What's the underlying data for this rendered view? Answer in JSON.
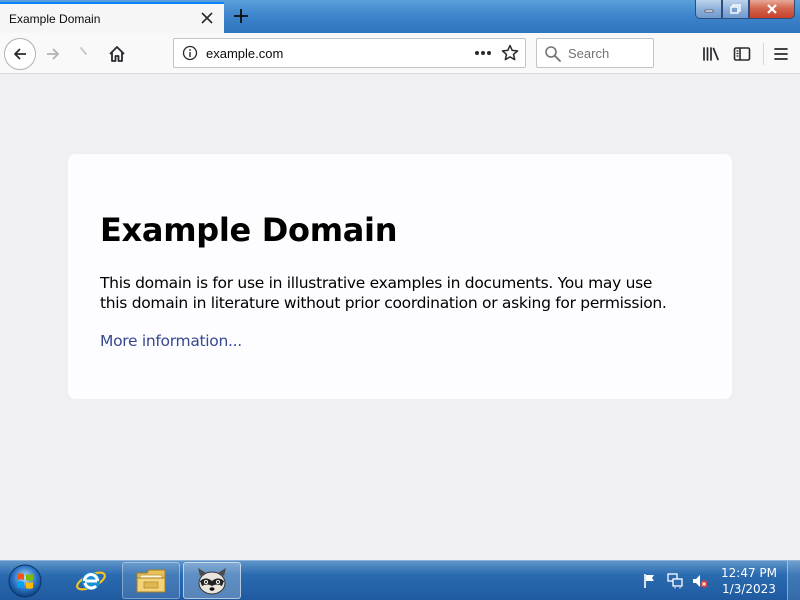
{
  "browser": {
    "tab": {
      "title": "Example Domain"
    },
    "window_controls": [
      "minimize",
      "maximize",
      "close"
    ],
    "urlbar": {
      "url": "example.com"
    },
    "search": {
      "placeholder": "Search"
    }
  },
  "page": {
    "heading": "Example Domain",
    "description": "This domain is for use in illustrative examples in documents. You may use this domain in literature without prior coordination or asking for permission.",
    "link_text": "More information..."
  },
  "taskbar": {
    "items": [
      "start-orb",
      "internet-explorer",
      "file-explorer",
      "app"
    ],
    "clock": {
      "time": "12:47 PM",
      "date": "1/3/2023"
    }
  },
  "colors": {
    "tab_accent": "#0a84ff",
    "page_background": "#f0f0f2",
    "card_background": "#fdfdff",
    "link": "#38488f"
  }
}
